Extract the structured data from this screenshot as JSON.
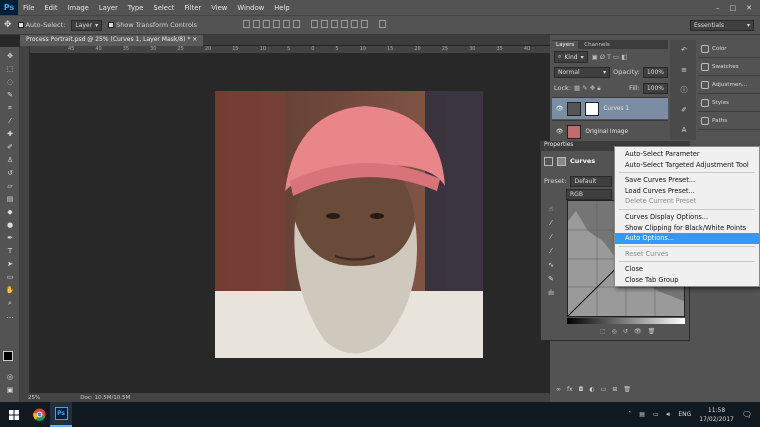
{
  "menubar": {
    "logo": "Ps",
    "items": [
      "File",
      "Edit",
      "Image",
      "Layer",
      "Type",
      "Select",
      "Filter",
      "View",
      "Window",
      "Help"
    ],
    "min": "–",
    "max": "□",
    "close": "✕"
  },
  "options": {
    "auto_select": "Auto-Select:",
    "auto_select_target": "Layer",
    "show_transform": "Show Transform Controls",
    "workspace": "Essentials"
  },
  "doc": {
    "tab_title": "Process Portrait.psd @ 25% (Curves 1, Layer Mask/8) *",
    "tab_close": "×",
    "zoom": "25%",
    "doc_size": "Doc: 10.5M/10.5M"
  },
  "ruler": {
    "ticks": [
      "45",
      "40",
      "35",
      "30",
      "25",
      "20",
      "15",
      "10",
      "5",
      "0",
      "5",
      "10",
      "15",
      "20",
      "25",
      "30",
      "35",
      "40",
      "45"
    ]
  },
  "layers": {
    "tabs": [
      "Layers",
      "Channels"
    ],
    "kind": "Kind",
    "blend": "Normal",
    "opacity_label": "Opacity:",
    "opacity": "100%",
    "lock_label": "Lock:",
    "fill_label": "Fill:",
    "fill": "100%",
    "rows": [
      {
        "name": "Curves 1"
      },
      {
        "name": "Original Image"
      }
    ]
  },
  "side_panels": [
    "Color",
    "Swatches",
    "Adjustmen...",
    "Styles",
    "Paths"
  ],
  "properties": {
    "title": "Properties",
    "adj": "Curves",
    "preset_label": "Preset:",
    "preset": "Default",
    "channel": "RGB",
    "auto": "Auto"
  },
  "context_menu": {
    "items": [
      {
        "label": "Auto-Select Parameter",
        "state": "normal"
      },
      {
        "label": "Auto-Select Targeted Adjustment Tool",
        "state": "normal"
      },
      {
        "sep": true
      },
      {
        "label": "Save Curves Preset...",
        "state": "normal"
      },
      {
        "label": "Load Curves Preset...",
        "state": "normal"
      },
      {
        "label": "Delete Current Preset",
        "state": "disabled"
      },
      {
        "sep": true
      },
      {
        "label": "Curves Display Options...",
        "state": "normal"
      },
      {
        "label": "Show Clipping for Black/White Points",
        "state": "normal"
      },
      {
        "label": "Auto Options...",
        "state": "highlight"
      },
      {
        "sep": true
      },
      {
        "label": "Reset Curves",
        "state": "disabled"
      },
      {
        "sep": true
      },
      {
        "label": "Close",
        "state": "normal"
      },
      {
        "label": "Close Tab Group",
        "state": "normal"
      }
    ]
  },
  "taskbar": {
    "lang": "ENG",
    "time": "11:58",
    "date": "17/02/2017"
  },
  "colors": {
    "highlight": "#3399ff",
    "turban": "#e8868a",
    "skin": "#6a4a38",
    "beard": "#cfc8bd"
  }
}
